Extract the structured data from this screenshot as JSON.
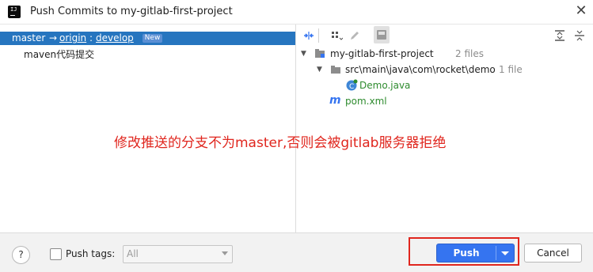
{
  "window": {
    "title": "Push Commits to my-gitlab-first-project",
    "app_icon": "IJ",
    "close_glyph": "✕"
  },
  "left": {
    "branch": {
      "local": "master",
      "arrow": "→",
      "remote": "origin",
      "colon": ":",
      "target": "develop",
      "badge": "New"
    },
    "commits": [
      {
        "message": "maven代码提交"
      }
    ]
  },
  "toolbar": {
    "icons": [
      "expand-diff-icon",
      "group-by-icon",
      "edit-icon",
      "show-diff-icon",
      "expand-all-icon",
      "collapse-all-icon"
    ]
  },
  "tree": {
    "root": {
      "name": "my-gitlab-first-project",
      "meta": "2 files"
    },
    "folder": {
      "name": "src\\main\\java\\com\\rocket\\demo",
      "meta": "1 file"
    },
    "files": [
      {
        "name": "Demo.java",
        "icon": "C",
        "color": "#2e8b2e"
      },
      {
        "name": "pom.xml",
        "icon": "m",
        "color": "#2e8b2e"
      }
    ]
  },
  "annotation": {
    "text": "修改推送的分支不为master,否则会被gitlab服务器拒绝",
    "color": "#e0261e"
  },
  "footer": {
    "help": "?",
    "push_tags_label": "Push tags:",
    "push_tags_checked": false,
    "tags_select_value": "All",
    "push_label": "Push",
    "cancel_label": "Cancel"
  },
  "colors": {
    "accent": "#3574f0",
    "selection": "#2675bf",
    "highlight": "#e0261e"
  }
}
